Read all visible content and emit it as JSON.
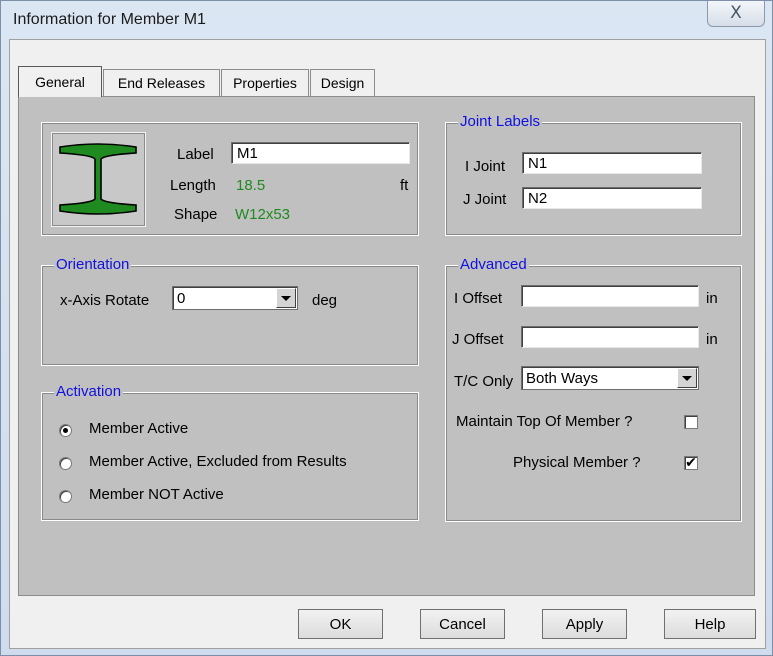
{
  "window": {
    "title": "Information for Member M1",
    "close_glyph": "X"
  },
  "tabs": [
    {
      "label": "General"
    },
    {
      "label": "End Releases"
    },
    {
      "label": "Properties"
    },
    {
      "label": "Design"
    }
  ],
  "member": {
    "label_caption": "Label",
    "label_value": "M1",
    "length_caption": "Length",
    "length_value": "18.5",
    "length_unit": "ft",
    "shape_caption": "Shape",
    "shape_value": "W12x53",
    "icon": "i-beam-icon",
    "icon_color": "#1f8a1f"
  },
  "joint_labels": {
    "title": "Joint Labels",
    "i_joint_caption": "I Joint",
    "i_joint_value": "N1",
    "j_joint_caption": "J Joint",
    "j_joint_value": "N2"
  },
  "orientation": {
    "title": "Orientation",
    "rotate_caption": "x-Axis Rotate",
    "rotate_value": "0",
    "rotate_unit": "deg"
  },
  "activation": {
    "title": "Activation",
    "options": [
      {
        "label": "Member Active",
        "checked": true
      },
      {
        "label": "Member Active, Excluded from Results",
        "checked": false
      },
      {
        "label": "Member NOT Active",
        "checked": false
      }
    ]
  },
  "advanced": {
    "title": "Advanced",
    "i_offset_caption": "I Offset",
    "i_offset_value": "",
    "i_offset_unit": "in",
    "j_offset_caption": "J Offset",
    "j_offset_value": "",
    "j_offset_unit": "in",
    "tc_only_caption": "T/C Only",
    "tc_only_value": "Both Ways",
    "maintain_top_caption": "Maintain Top Of Member ?",
    "maintain_top_checked": false,
    "physical_member_caption": "Physical Member ?",
    "physical_member_checked": true,
    "check_glyph": "✔"
  },
  "buttons": {
    "ok": "OK",
    "cancel": "Cancel",
    "apply": "Apply",
    "help": "Help"
  },
  "colors": {
    "group_title": "#1010e0",
    "value_green": "#1f8a1f",
    "panel_bg": "#c0c0c0"
  }
}
